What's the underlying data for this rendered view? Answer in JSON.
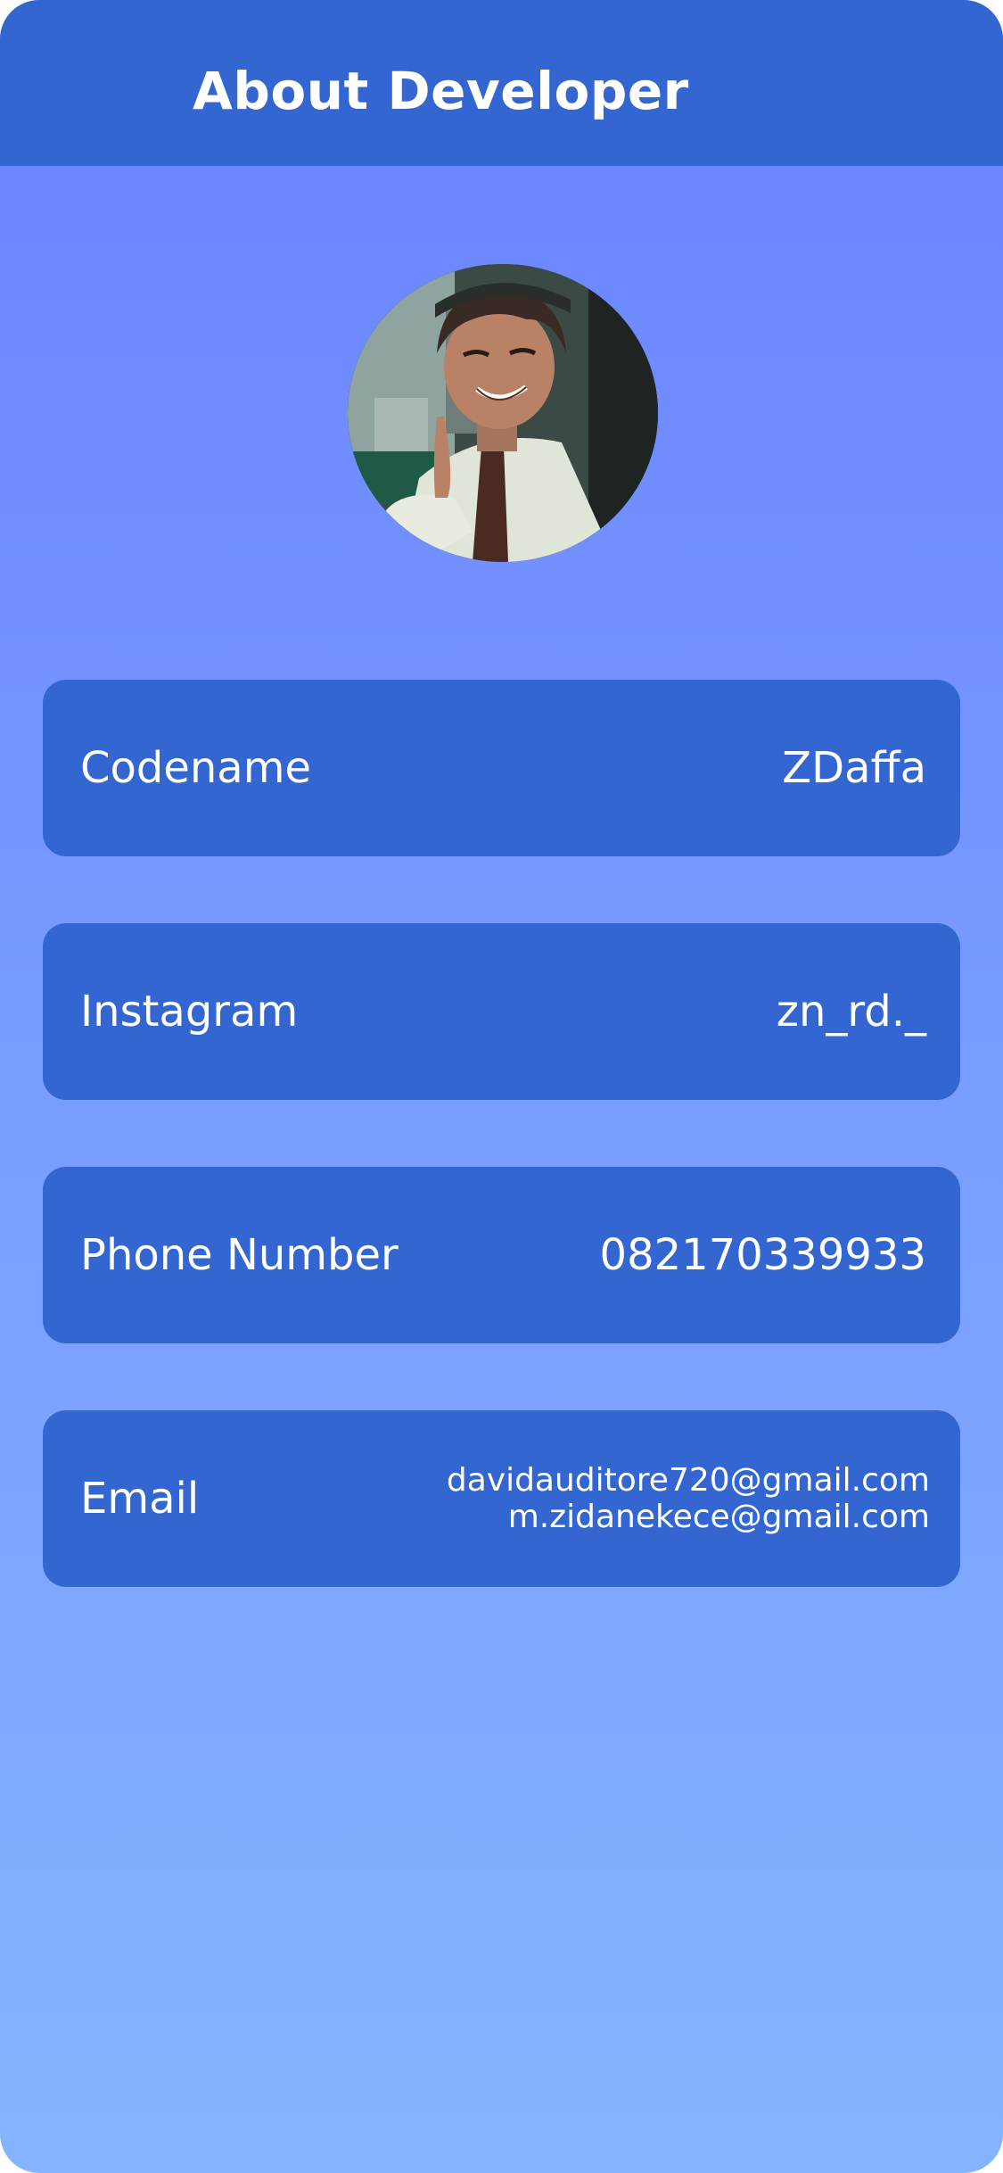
{
  "header": {
    "title": "About Developer"
  },
  "avatar": {
    "description_icon": "developer-avatar"
  },
  "info_cards": [
    {
      "label": "Codename",
      "value": "ZDaffa"
    },
    {
      "label": "Instagram",
      "value": "zn_rd._"
    },
    {
      "label": "Phone Number",
      "value": "082170339933"
    },
    {
      "label": "Email",
      "values": [
        "davidauditore720@gmail.com",
        "m.zidanekece@gmail.com"
      ]
    }
  ],
  "colors": {
    "header_bg": "#3366d1",
    "card_bg": "#3366d1",
    "gradient_top": "#6a82ff",
    "gradient_bottom": "#84b4ff",
    "text": "#ffffff"
  }
}
